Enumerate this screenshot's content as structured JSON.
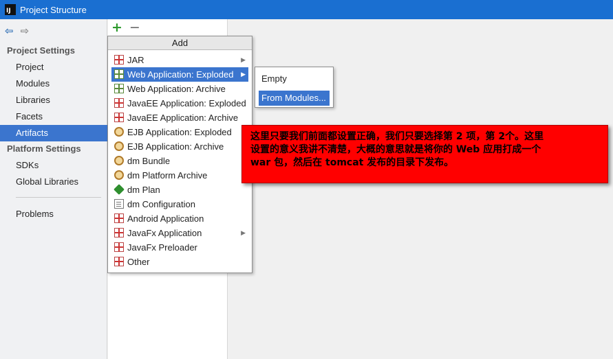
{
  "window": {
    "title": "Project Structure",
    "logo": "IJ"
  },
  "nav": {
    "back_icon": "arrow-left-icon",
    "forward_icon": "arrow-right-icon"
  },
  "sidebar": {
    "project_settings_header": "Project Settings",
    "project_items": [
      "Project",
      "Modules",
      "Libraries",
      "Facets",
      "Artifacts"
    ],
    "selected": "Artifacts",
    "platform_settings_header": "Platform Settings",
    "platform_items": [
      "SDKs",
      "Global Libraries"
    ],
    "other_items": [
      "Problems"
    ]
  },
  "toolbar": {
    "add_symbol": "+",
    "remove_symbol": "−"
  },
  "add_menu": {
    "header": "Add",
    "items": [
      {
        "label": "JAR",
        "icon": "gift-icon",
        "has_submenu": true
      },
      {
        "label": "Web Application: Exploded",
        "icon": "gift-web-icon",
        "has_submenu": true,
        "highlighted": true
      },
      {
        "label": "Web Application: Archive",
        "icon": "gift-web-icon",
        "has_submenu": false
      },
      {
        "label": "JavaEE Application: Exploded",
        "icon": "gift-icon",
        "has_submenu": false
      },
      {
        "label": "JavaEE Application: Archive",
        "icon": "gift-icon",
        "has_submenu": false
      },
      {
        "label": "EJB Application: Exploded",
        "icon": "gear-icon",
        "has_submenu": false
      },
      {
        "label": "EJB Application: Archive",
        "icon": "gear-icon",
        "has_submenu": false
      },
      {
        "label": "dm Bundle",
        "icon": "gear-icon",
        "has_submenu": false
      },
      {
        "label": "dm Platform Archive",
        "icon": "gear-icon",
        "has_submenu": false
      },
      {
        "label": "dm Plan",
        "icon": "plan-icon",
        "has_submenu": false
      },
      {
        "label": "dm Configuration",
        "icon": "document-icon",
        "has_submenu": false
      },
      {
        "label": "Android Application",
        "icon": "gift-icon",
        "has_submenu": false
      },
      {
        "label": "JavaFx Application",
        "icon": "gift-icon",
        "has_submenu": true
      },
      {
        "label": "JavaFx Preloader",
        "icon": "gift-icon",
        "has_submenu": false
      },
      {
        "label": "Other",
        "icon": "gift-icon",
        "has_submenu": false
      }
    ]
  },
  "submenu": {
    "items": [
      "Empty",
      "From Modules..."
    ],
    "highlighted": "From Modules..."
  },
  "annotation": {
    "line1": "这里只要我们前面都设置正确，我们只要选择第 2 项，第 2个。这里",
    "line2": "设置的意义我讲不清楚，大概的意思就是将你的 Web 应用打成一个",
    "line3": "war 包，然后在 tomcat 发布的目录下发布。"
  },
  "colors": {
    "title_bar": "#1a6fd1",
    "selection": "#3b75ce",
    "annotation_bg": "#ff0000"
  }
}
